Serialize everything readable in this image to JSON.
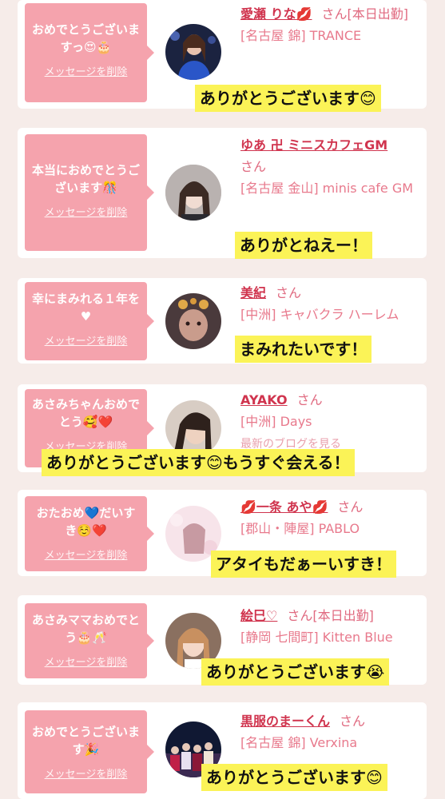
{
  "cards": [
    {
      "message": "おめでとうございますっ😍🎂",
      "delete_label": "メッセージを削除",
      "name": "愛瀬 りな💋",
      "honorific": "さん",
      "status": "[本日出勤]",
      "shop": "[名古屋 錦] TRANCE",
      "reply": "ありがとうございます😊"
    },
    {
      "message": "本当におめでとうございます🎊",
      "delete_label": "メッセージを削除",
      "name": "ゆあ 卍 ミニスカフェGM",
      "honorific": "さん",
      "shop": "[名古屋 金山] minis cafe GM",
      "reply": "ありがとねえー！"
    },
    {
      "message": "幸にまみれる１年を♥",
      "delete_label": "メッセージを削除",
      "name": "美紀",
      "honorific": "さん",
      "shop": "[中洲] キャバクラ ハーレム",
      "reply": "まみれたいです！"
    },
    {
      "message": "あさみちゃんおめでとう🥰❤️",
      "delete_label": "メッセージを削除",
      "name": "AYAKO",
      "honorific": "さん",
      "shop": "[中洲] Days",
      "extra": "最新のブログを見る",
      "reply": "ありがとうございます😊もうすぐ会える！"
    },
    {
      "message": "おたおめ💙だいすき☺️❤️",
      "delete_label": "メッセージを削除",
      "name": "💋一条 あや💋",
      "honorific": "さん",
      "shop": "[郡山・陣屋] PABLO",
      "reply": "アタイもだぁーいすき！"
    },
    {
      "message": "あさみママおめでとう🎂🥂",
      "delete_label": "メッセージを削除",
      "name": "絵巳♡",
      "honorific": "さん",
      "status": "[本日出勤]",
      "shop": "[静岡 七間町] Kitten Blue",
      "reply": "ありがとうございます😭"
    },
    {
      "message": "おめでとうございます🎉",
      "delete_label": "メッセージを削除",
      "name": "黒服のまーくん",
      "honorific": "さん",
      "shop": "[名古屋 錦] Verxina",
      "reply": "ありがとうございます😊"
    }
  ]
}
